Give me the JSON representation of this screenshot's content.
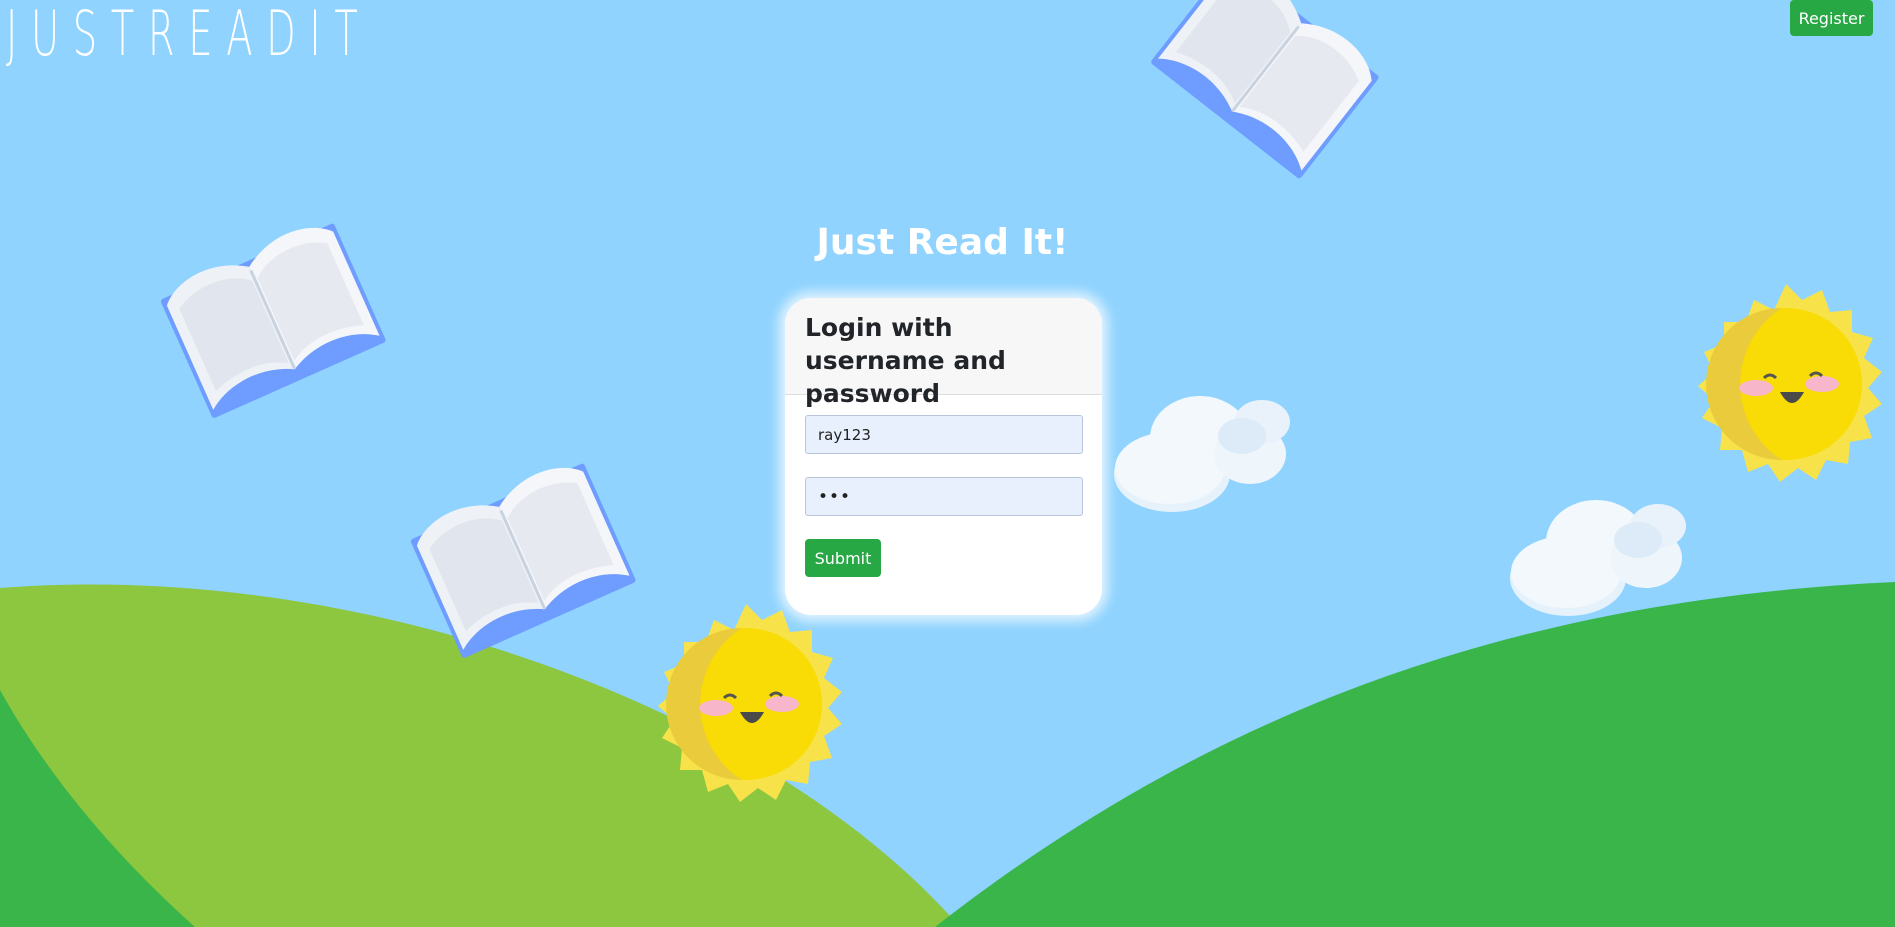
{
  "header": {
    "logo_text": "JUSTREADIT",
    "register_label": "Register"
  },
  "main": {
    "title": "Just Read It!",
    "login": {
      "heading": "Login with username and password",
      "username_value": "ray123",
      "password_value": "abc",
      "submit_label": "Submit"
    }
  },
  "colors": {
    "sky": "#8fd3fe",
    "accent_green": "#28a745",
    "hill_light": "#8dc63f",
    "hill_dark": "#39b54a",
    "sun": "#f9dc05",
    "book_cover": "#6e9cff"
  },
  "decorations": {
    "icons": [
      "open-book-icon",
      "sun-face-icon",
      "cloud-icon"
    ]
  }
}
